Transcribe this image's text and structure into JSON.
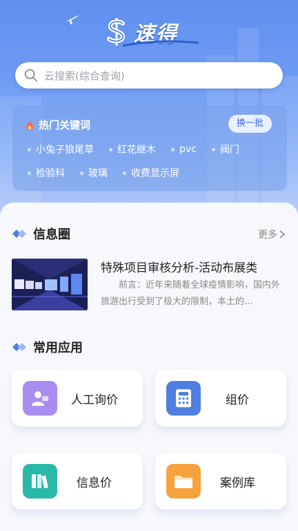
{
  "header": {
    "brand_name": "速得",
    "search_placeholder": "云搜索(综合查询)"
  },
  "hot_keywords": {
    "title": "热门关键词",
    "refresh_label": "换一批",
    "row1": [
      "小兔子狼尾草",
      "红花继木",
      "pvc",
      "阀门"
    ],
    "row2": [
      "检验科",
      "玻璃",
      "收费显示屏"
    ]
  },
  "info_circle": {
    "title": "信息圈",
    "more_label": "更多",
    "article": {
      "title": "特殊项目审核分析-活动布展类",
      "excerpt": "前言：近年来随着全球疫情影响，国内外旅游出行受到了极大的限制，本土的..."
    }
  },
  "apps": {
    "title": "常用应用",
    "items": [
      {
        "label": "人工询价",
        "icon": "customer-service-icon",
        "color": "#a98cf0"
      },
      {
        "label": "组价",
        "icon": "calculator-icon",
        "color": "#4f7fe0"
      },
      {
        "label": "信息价",
        "icon": "books-icon",
        "color": "#27b8a8"
      },
      {
        "label": "案例库",
        "icon": "folder-icon",
        "color": "#f7a23c"
      }
    ]
  }
}
